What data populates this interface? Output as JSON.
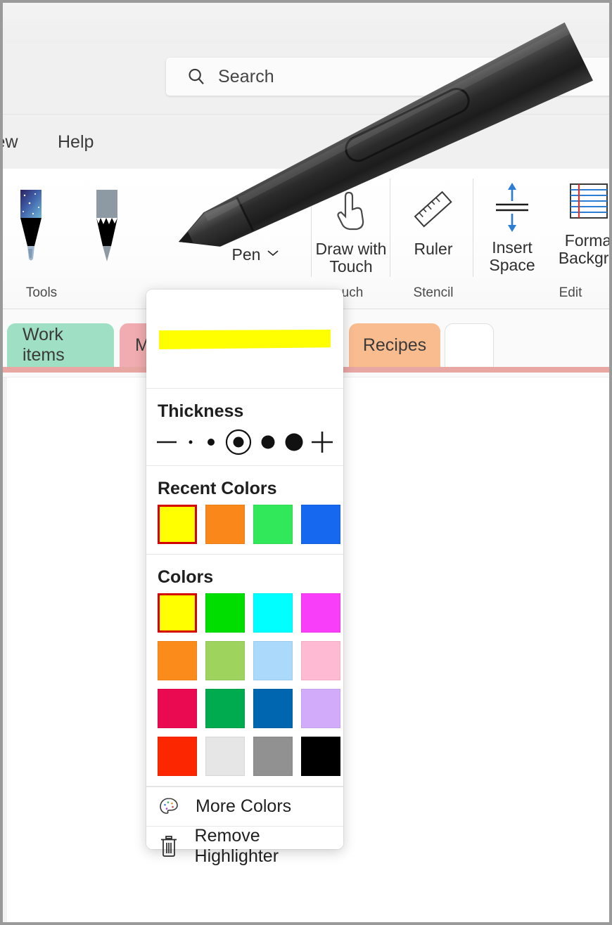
{
  "app": {
    "window_chrome_color": "#f0f0f0"
  },
  "search": {
    "placeholder": "Search",
    "icon": "search-icon"
  },
  "ribbon_tabs": [
    {
      "label": "iew"
    },
    {
      "label": "Help"
    }
  ],
  "ribbon": {
    "groups": [
      {
        "label": "Tools"
      },
      {
        "label": "uch"
      },
      {
        "label": "Stencil"
      },
      {
        "label": "Edit"
      }
    ],
    "tools": {
      "galaxy_pen": {
        "icon": "galaxy-pen-icon",
        "label": ""
      },
      "pencil": {
        "icon": "pencil-icon",
        "label": ""
      },
      "highlighter": {
        "icon": "highlighter-icon",
        "label": "",
        "selected": true,
        "chevron": "chevron-down-icon"
      },
      "add_pen": {
        "icon": "plus-icon",
        "label": "Pen",
        "chevron": "chevron-down-icon",
        "accent": "#2e9e57"
      },
      "draw_with_touch": {
        "icon": "hand-touch-icon",
        "line1": "Draw with",
        "line2": "Touch"
      },
      "ruler": {
        "icon": "ruler-icon",
        "label": "Ruler"
      },
      "insert_space": {
        "icon": "insert-space-icon",
        "line1": "Insert",
        "line2": "Space"
      },
      "format_background": {
        "icon": "ruled-paper-icon",
        "line1": "Forma",
        "line2": "Backgro"
      }
    }
  },
  "section_tabs": [
    {
      "label": "Work items",
      "color": "#9fdfc4"
    },
    {
      "label": "M",
      "color": "#f0acb0"
    },
    {
      "label": "Recipes",
      "color": "#f9bc8f"
    },
    {
      "label": "",
      "color": "#ffffff",
      "is_add": true
    }
  ],
  "flyout": {
    "preview": {
      "stroke_color": "#ffff00"
    },
    "thickness": {
      "title": "Thickness",
      "decrease_icon": "minus-icon",
      "increase_icon": "plus-icon",
      "steps": [
        {
          "size": 5,
          "selected": false
        },
        {
          "size": 10,
          "selected": false
        },
        {
          "size": 15,
          "selected": true
        },
        {
          "size": 19,
          "selected": false
        },
        {
          "size": 25,
          "selected": false
        }
      ],
      "selected_index": 2
    },
    "recent_colors": {
      "title": "Recent Colors",
      "swatches": [
        {
          "color": "#ffff00",
          "selected": true
        },
        {
          "color": "#f98719",
          "selected": false
        },
        {
          "color": "#31e85a",
          "selected": false
        },
        {
          "color": "#1668ef",
          "selected": false
        }
      ]
    },
    "colors": {
      "title": "Colors",
      "swatches": [
        {
          "color": "#ffff00",
          "selected": true
        },
        {
          "color": "#00de00",
          "selected": false
        },
        {
          "color": "#00ffff",
          "selected": false
        },
        {
          "color": "#f93ef9",
          "selected": false
        },
        {
          "color": "#fb8c1c",
          "selected": false
        },
        {
          "color": "#9ed35e",
          "selected": false
        },
        {
          "color": "#abd9fb",
          "selected": false
        },
        {
          "color": "#febad3",
          "selected": false
        },
        {
          "color": "#ea0a51",
          "selected": false
        },
        {
          "color": "#00ab50",
          "selected": false
        },
        {
          "color": "#0066b0",
          "selected": false
        },
        {
          "color": "#d2abfb",
          "selected": false
        },
        {
          "color": "#fc2600",
          "selected": false
        },
        {
          "color": "#e6e6e6",
          "selected": false
        },
        {
          "color": "#919191",
          "selected": false
        },
        {
          "color": "#000000",
          "selected": false
        }
      ]
    },
    "actions": [
      {
        "label": "More Colors",
        "icon": "palette-icon"
      },
      {
        "label": "Remove Highlighter",
        "icon": "trash-icon"
      }
    ]
  }
}
